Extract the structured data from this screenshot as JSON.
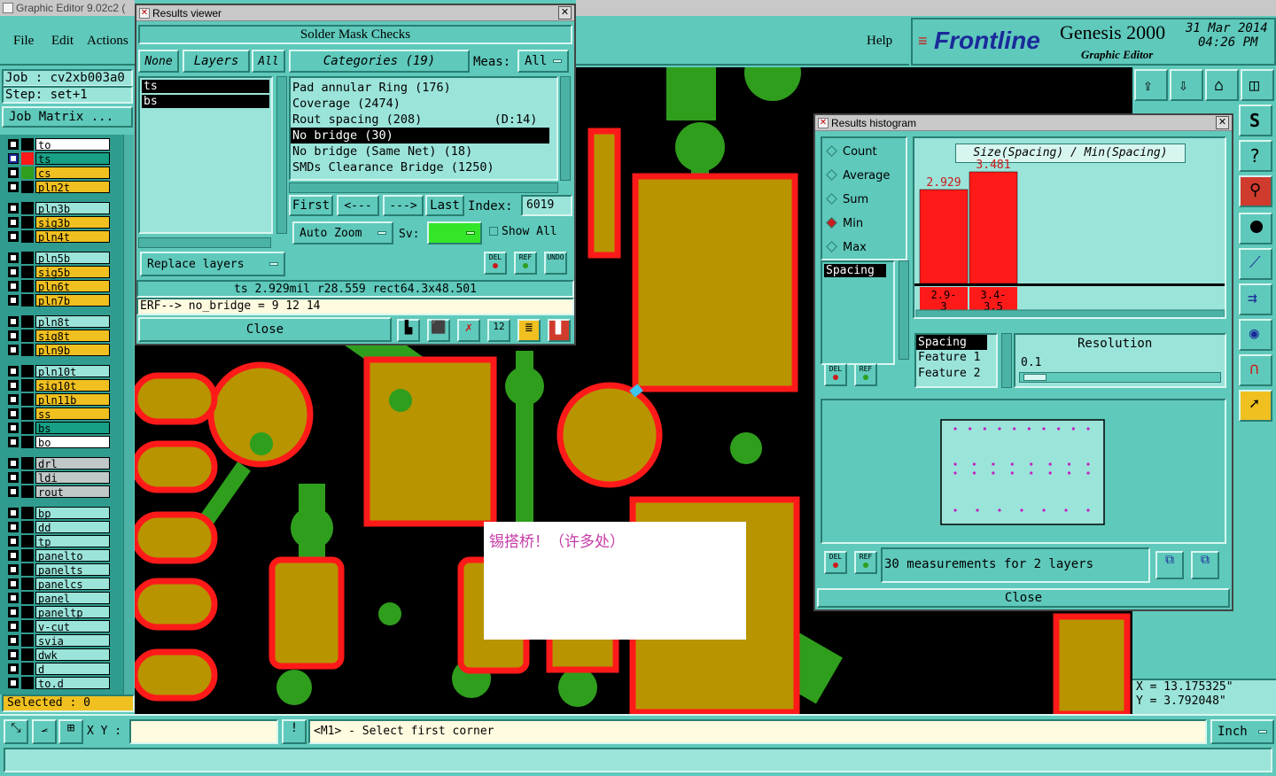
{
  "app": {
    "title": "Graphic Editor 9.02c2 (",
    "menu": [
      "File",
      "Edit",
      "Actions"
    ],
    "help": "Help"
  },
  "brand": {
    "logo": "Frontline",
    "product": "Genesis 2000",
    "subtitle": "Graphic Editor",
    "date": "31 Mar 2014",
    "time": "04:26 PM"
  },
  "job": {
    "job": "Job : cv2xb003a0",
    "step": "Step: set+1",
    "matrix": "Job Matrix ..."
  },
  "layers": [
    {
      "name": "to",
      "color": "#ffffff"
    },
    {
      "name": "ts",
      "color": "#17a085"
    },
    {
      "name": "cs",
      "color": "#f0c020"
    },
    {
      "name": "pln2t",
      "color": "#f0c020"
    },
    {
      "name": "pln3b",
      "color": "#9be4da"
    },
    {
      "name": "sig3b",
      "color": "#f0c020"
    },
    {
      "name": "pln4t",
      "color": "#f0c020"
    },
    {
      "name": "pln5b",
      "color": "#9be4da"
    },
    {
      "name": "sig5b",
      "color": "#f0c020"
    },
    {
      "name": "pln6t",
      "color": "#f0c020"
    },
    {
      "name": "pln7b",
      "color": "#f0c020"
    },
    {
      "name": "pln8t",
      "color": "#9be4da"
    },
    {
      "name": "sig8t",
      "color": "#f0c020"
    },
    {
      "name": "pln9b",
      "color": "#f0c020"
    },
    {
      "name": "pln10t",
      "color": "#9be4da"
    },
    {
      "name": "sig10t",
      "color": "#f0c020"
    },
    {
      "name": "pln11b",
      "color": "#f0c020"
    },
    {
      "name": "ss",
      "color": "#f0c020"
    },
    {
      "name": "bs",
      "color": "#17a085"
    },
    {
      "name": "bo",
      "color": "#ffffff"
    },
    {
      "name": "drl",
      "color": "#c0c8c8"
    },
    {
      "name": "ldi",
      "color": "#c0c8c8"
    },
    {
      "name": "rout",
      "color": "#c0c8c8"
    },
    {
      "name": "bp",
      "color": "#9be4da"
    },
    {
      "name": "dd",
      "color": "#9be4da"
    },
    {
      "name": "tp",
      "color": "#9be4da"
    },
    {
      "name": "panelto",
      "color": "#9be4da"
    },
    {
      "name": "panelts",
      "color": "#9be4da"
    },
    {
      "name": "panelcs",
      "color": "#9be4da"
    },
    {
      "name": "panel",
      "color": "#9be4da"
    },
    {
      "name": "paneltp",
      "color": "#9be4da"
    },
    {
      "name": "v-cut",
      "color": "#9be4da"
    },
    {
      "name": "svia",
      "color": "#9be4da"
    },
    {
      "name": "dwk",
      "color": "#9be4da"
    },
    {
      "name": "d",
      "color": "#9be4da"
    },
    {
      "name": "to.d",
      "color": "#9be4da"
    }
  ],
  "selected": "Selected : 0",
  "results_viewer": {
    "title": "Results viewer",
    "header": "Solder Mask Checks",
    "none": "None",
    "layers": "Layers",
    "all": "All",
    "categories": "Categories (19)",
    "meas_label": "Meas:",
    "meas_value": "All",
    "layer_list": [
      "ts",
      "bs"
    ],
    "cat_list": [
      "Pad annular Ring (176)",
      "Coverage (2474)",
      "Rout spacing (208)          (D:14)",
      "No bridge (30)",
      "No bridge (Same Net) (18)",
      "SMDs Clearance Bridge (1250)"
    ],
    "first": "First",
    "prev": "<---",
    "next": "--->",
    "last": "Last",
    "index_label": "Index:",
    "index_value": "6019",
    "auto_zoom": "Auto Zoom",
    "sv": "Sv:",
    "show_all": "Show All",
    "replace_layers": "Replace layers",
    "info": "ts 2.929mil   r28.559   rect64.3x48.501",
    "erf": "ERF--> no_bridge = 9 12 14",
    "close": "Close",
    "del": "DEL",
    "ref": "REF",
    "undo": "UNDO"
  },
  "histogram": {
    "title": "Results histogram",
    "options": [
      "Count",
      "Average",
      "Sum",
      "Min",
      "Max"
    ],
    "chart_title": "Size(Spacing) / Min(Spacing)",
    "spacing": "Spacing",
    "features": [
      "Spacing",
      "Feature 1",
      "Feature 2"
    ],
    "resolution_label": "Resolution",
    "resolution_value": "0.1",
    "summary": "30 measurements for 2 layers",
    "close": "Close",
    "del": "DEL",
    "ref": "REF"
  },
  "chart_data": {
    "type": "bar",
    "title": "Size(Spacing) / Min(Spacing)",
    "categories": [
      "2.9-3",
      "3.4-3.5"
    ],
    "values": [
      2.929,
      3.481
    ],
    "value_labels": [
      "2.929",
      "3.481"
    ]
  },
  "canvas": {
    "annotation": "锡搭桥！（许多处）"
  },
  "status": {
    "xy_label": "X Y :",
    "prompt": "<M1> - Select first corner",
    "unit": "Inch",
    "x": "X = 13.175325\"",
    "y": "Y = 3.792048\""
  }
}
